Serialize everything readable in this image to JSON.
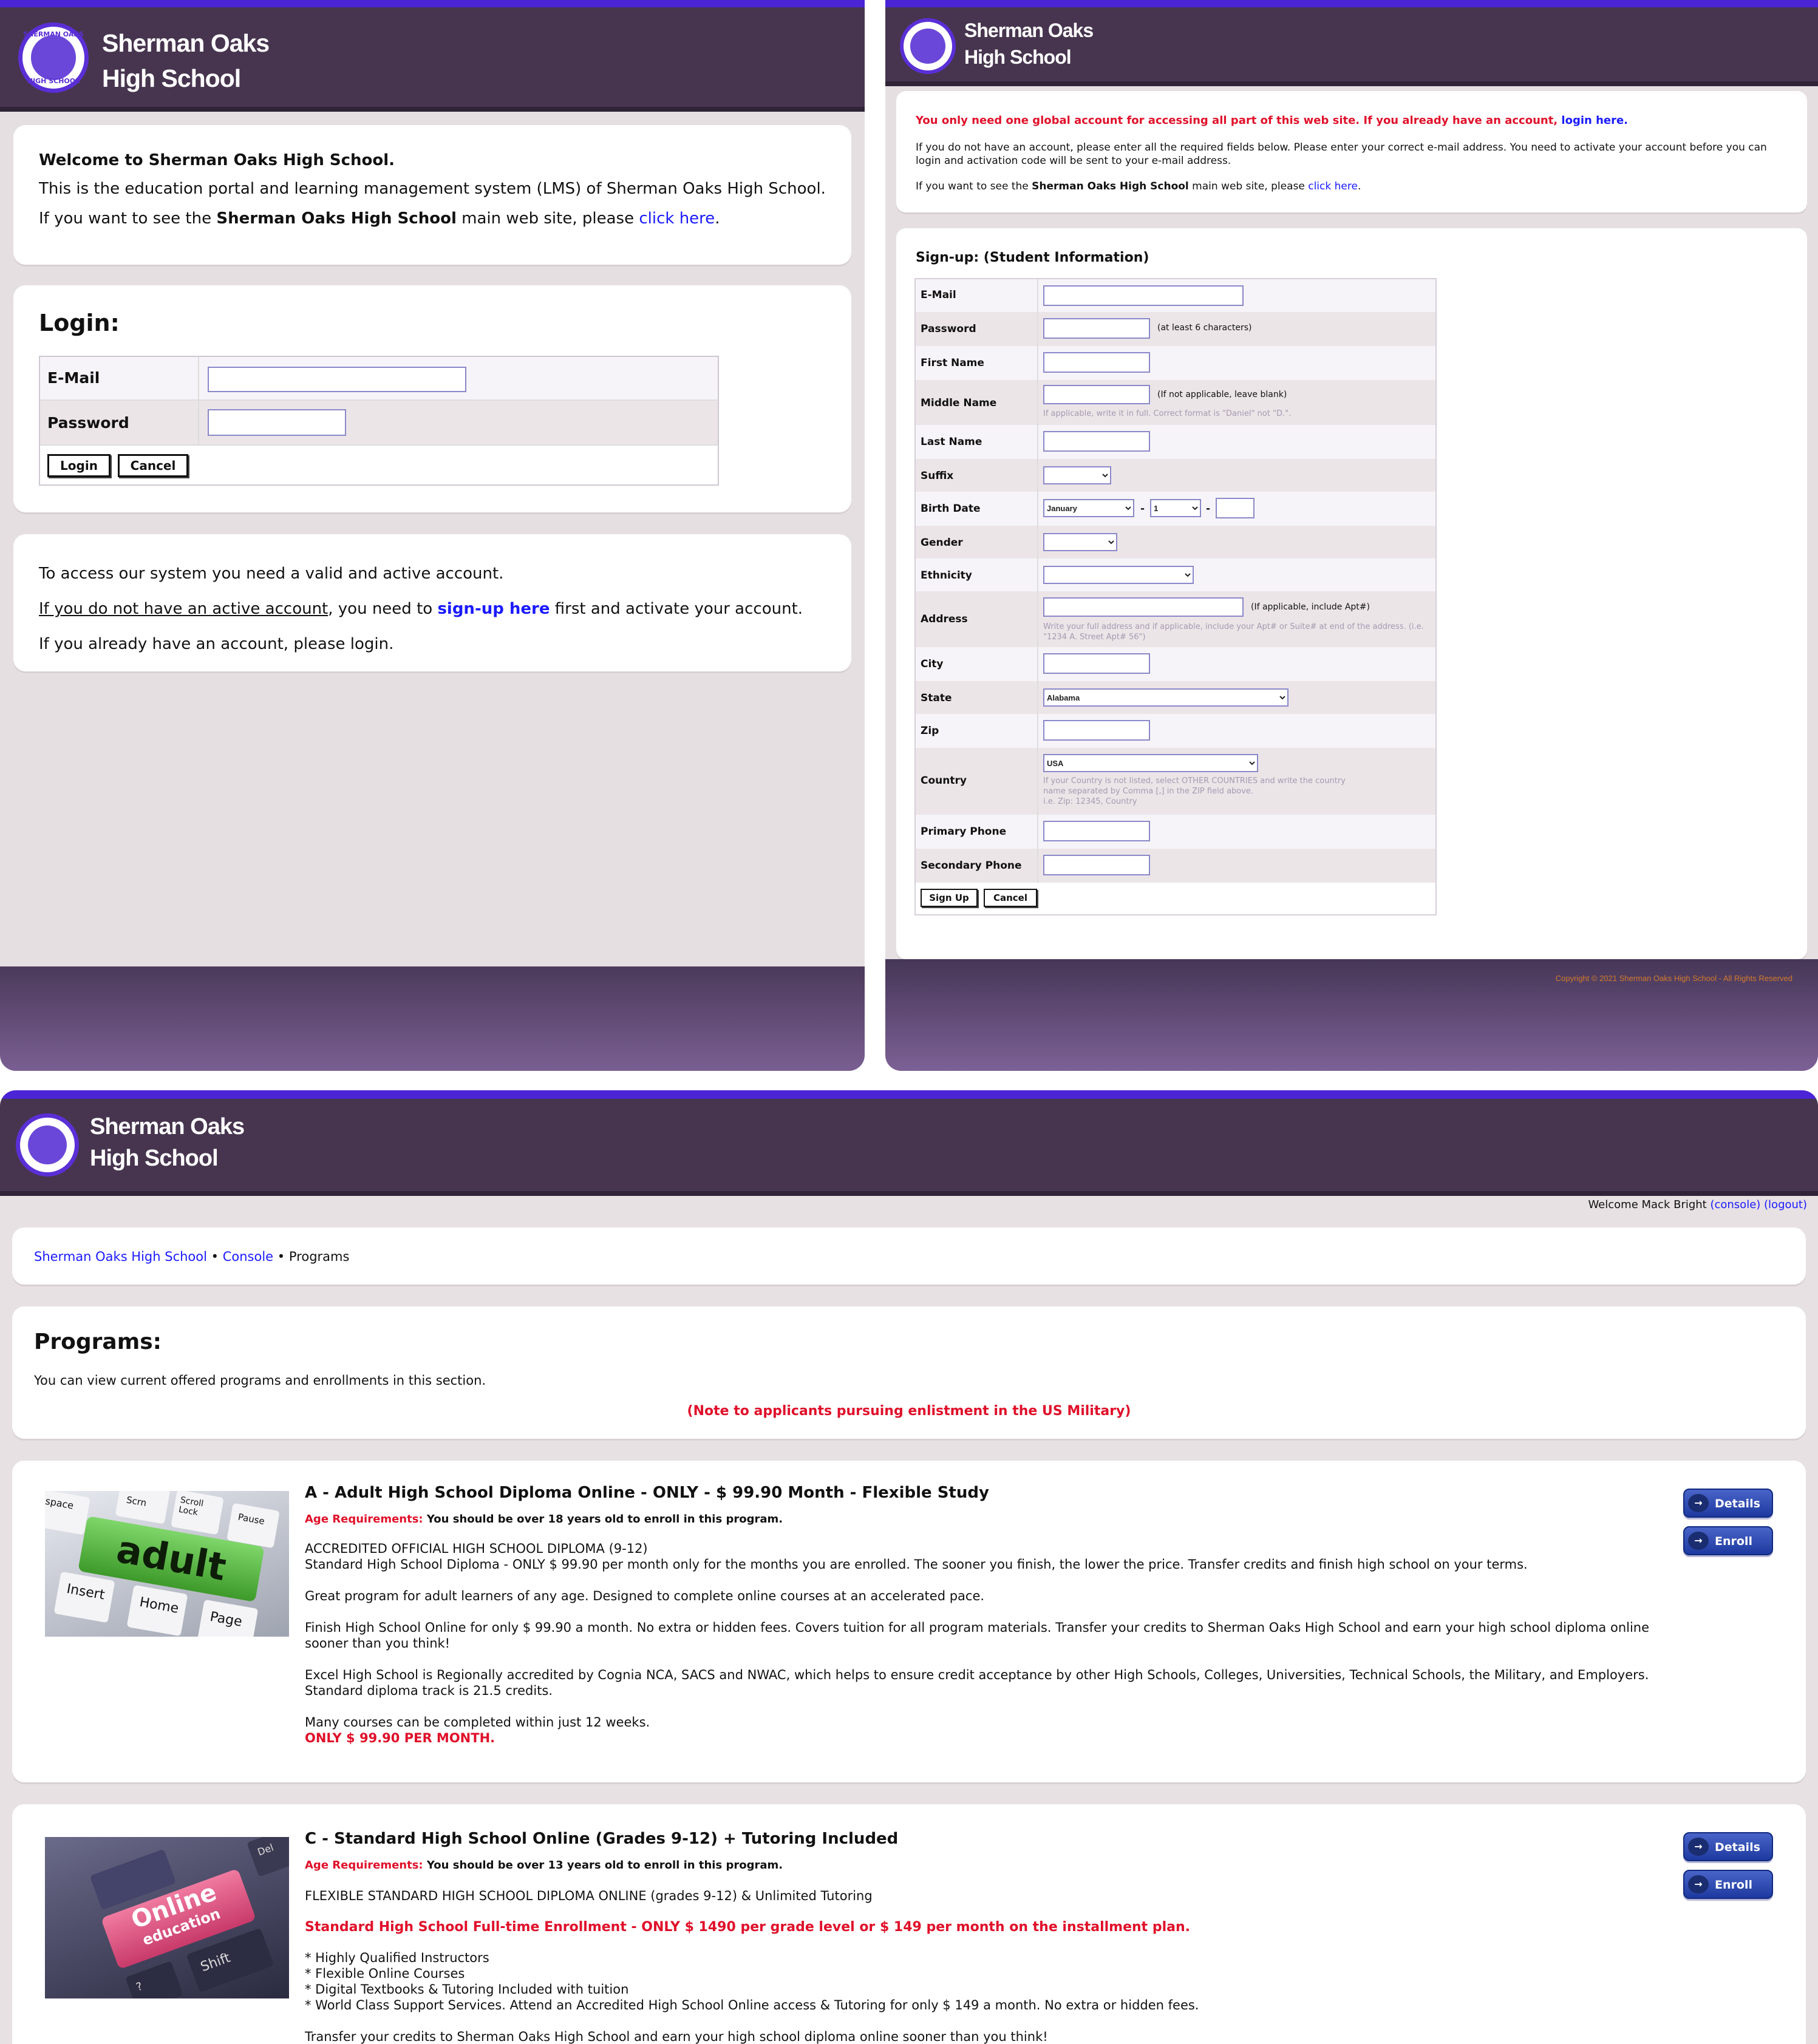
{
  "brand": {
    "line1": "Sherman Oaks",
    "line2": "High School",
    "seal_top": "SHERMAN OAKS",
    "seal_bottom": "HIGH SCHOOL"
  },
  "login_page": {
    "welcome_heading": "Welcome to Sherman Oaks High School.",
    "intro": "This is the education portal and learning management system (LMS) of Sherman Oaks High School.",
    "see_main_prefix": "If you want to see the ",
    "see_main_bold": "Sherman Oaks High School",
    "see_main_mid": " main web site, please ",
    "click_here": "click here",
    "period": ".",
    "login_title": "Login:",
    "email_label": "E-Mail",
    "password_label": "Password",
    "login_button": "Login",
    "cancel_button": "Cancel",
    "access_line": "To access our system you need a valid and active account.",
    "no_account_underlined": "If you do not have an active account",
    "no_account_mid": ", you need to ",
    "signup_link": "sign-up here",
    "no_account_end": " first and activate your account.",
    "already_line": "If you already have an account, please login."
  },
  "signup_page": {
    "notice_red": "You only need one global account for accessing all part of this web site. If you already have an account, ",
    "login_here": "login here.",
    "instructions": "If you do not have an account, please enter all the required fields below. Please enter your correct e-mail address. You need to activate your account before you can login and activation code will be sent to your e-mail address.",
    "see_main_prefix": "If you want to see the ",
    "see_main_bold": "Sherman Oaks High School",
    "see_main_mid": " main web site, please ",
    "click_here": "click here",
    "period": ".",
    "form_title": "Sign-up: (Student Information)",
    "labels": {
      "email": "E-Mail",
      "password": "Password",
      "first_name": "First Name",
      "middle_name": "Middle Name",
      "last_name": "Last Name",
      "suffix": "Suffix",
      "birth_date": "Birth Date",
      "gender": "Gender",
      "ethnicity": "Ethnicity",
      "address": "Address",
      "city": "City",
      "state": "State",
      "zip": "Zip",
      "country": "Country",
      "primary_phone": "Primary Phone",
      "secondary_phone": "Secondary Phone"
    },
    "hints": {
      "password": "(at least 6 characters)",
      "middle_name": "(If not applicable, leave blank)",
      "middle_name_help": "If applicable, write it in full. Correct format is \"Daniel\" not \"D.\".",
      "address": "(If applicable, include Apt#)",
      "address_help": "Write your full address and if applicable, include your Apt# or Suite# at end of the address. (i.e. \"1234 A. Street Apt# 56\")",
      "country_help_1": "If your Country is not listed, select OTHER COUNTRIES and write the country",
      "country_help_2": "name separated by Comma [,] in the ZIP field above.",
      "country_help_3": "i.e. Zip: 12345, Country"
    },
    "birth_month": "January",
    "birth_day": "1",
    "date_sep": "-",
    "state_value": "Alabama",
    "country_value": "USA",
    "signup_button": "Sign Up",
    "cancel_button": "Cancel",
    "copyright": "Copyright © 2021 Sherman Oaks High School - All Rights Reserved"
  },
  "programs_page": {
    "welcome_prefix": "Welcome Mack Bright ",
    "console_link": "(console)",
    "logout_link": "(logout)",
    "breadcrumb": {
      "home": "Sherman Oaks High School",
      "sep": "•",
      "console": "Console",
      "current": "Programs"
    },
    "title": "Programs:",
    "intro": "You can view current offered programs and enrollments in this section.",
    "military_note": "(Note to applicants pursuing enlistment in the US Military)",
    "details_button": "Details",
    "enroll_button": "Enroll",
    "age_label": "Age Requirements:",
    "programs": [
      {
        "image_text": "adult",
        "image_keys": [
          "space",
          "Scrn",
          "Scroll Lock",
          "Pause",
          "Insert",
          "Home",
          "Page"
        ],
        "title": "A - Adult High School Diploma Online - ONLY - $ 99.90 Month - Flexible Study",
        "age": "You should be over 18 years old to enroll in this program.",
        "line1": "ACCREDITED OFFICIAL HIGH SCHOOL DIPLOMA (9-12)",
        "line2": "Standard High School Diploma - ONLY $ 99.90 per month only for the months you are enrolled. The sooner you finish, the lower the price. Transfer credits and finish high school on your terms.",
        "p2": "Great program for adult learners of any age. Designed to complete online courses at an accelerated pace.",
        "p3": "Finish High School Online for only $ 99.90 a month. No extra or hidden fees. Covers tuition for all program materials. Transfer your credits to Sherman Oaks High School and earn your high school diploma online sooner than you think!",
        "p4": "Excel High School is Regionally accredited by Cognia NCA, SACS and NWAC, which helps to ensure credit acceptance by other High Schools, Colleges, Universities, Technical Schools, the Military, and Employers. Standard diploma track is 21.5 credits.",
        "p5": "Many courses can be completed within just 12 weeks.",
        "p5_red": "ONLY $ 99.90 PER MONTH."
      },
      {
        "image_text_1": "Online",
        "image_text_2": "education",
        "image_keys": [
          "Del",
          "Shift",
          "?"
        ],
        "title": "C - Standard High School Online (Grades 9-12) + Tutoring Included",
        "age": "You should be over 13 years old to enroll in this program.",
        "line1": "FLEXIBLE STANDARD HIGH SCHOOL DIPLOMA ONLINE (grades 9-12) & Unlimited Tutoring",
        "red_line": "Standard High School Full-time Enrollment - ONLY $ 1490 per grade level or $ 149 per month on the installment plan.",
        "bullets": [
          "* Highly Qualified Instructors",
          "* Flexible Online Courses",
          "* Digital Textbooks & Tutoring Included with tuition",
          "* World Class Support Services. Attend an Accredited High School Online access & Tutoring for only $ 149 a month. No extra or hidden fees."
        ],
        "cut_line": "Transfer your credits to Sherman Oaks High School and earn your high school diploma online sooner than you think!"
      }
    ]
  },
  "colors": {
    "accent": "#4b24d6",
    "header": "#47354f",
    "panel_bg": "#e6dfe1",
    "link": "#1a1aff",
    "alert": "#e0102a",
    "button_blue": "#2a45b0"
  }
}
